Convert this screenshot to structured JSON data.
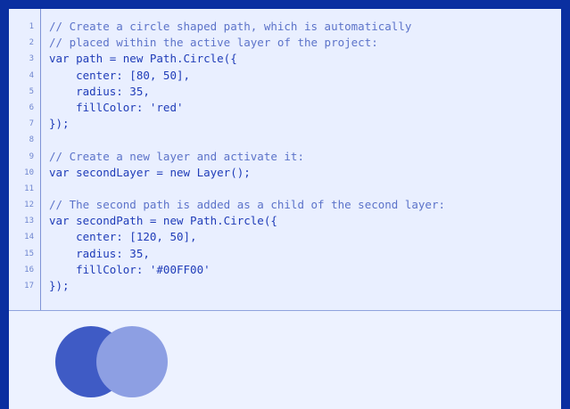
{
  "code_lines": [
    {
      "n": "1",
      "text": "// Create a circle shaped path, which is automatically",
      "kind": "comment"
    },
    {
      "n": "2",
      "text": "// placed within the active layer of the project:",
      "kind": "comment"
    },
    {
      "n": "3",
      "text": "var path = new Path.Circle({",
      "kind": "code"
    },
    {
      "n": "4",
      "text": "    center: [80, 50],",
      "kind": "code"
    },
    {
      "n": "5",
      "text": "    radius: 35,",
      "kind": "code"
    },
    {
      "n": "6",
      "text": "    fillColor: 'red'",
      "kind": "code"
    },
    {
      "n": "7",
      "text": "});",
      "kind": "code"
    },
    {
      "n": "8",
      "text": "",
      "kind": "code"
    },
    {
      "n": "9",
      "text": "// Create a new layer and activate it:",
      "kind": "comment"
    },
    {
      "n": "10",
      "text": "var secondLayer = new Layer();",
      "kind": "code"
    },
    {
      "n": "11",
      "text": "",
      "kind": "code"
    },
    {
      "n": "12",
      "text": "// The second path is added as a child of the second layer:",
      "kind": "comment"
    },
    {
      "n": "13",
      "text": "var secondPath = new Path.Circle({",
      "kind": "code"
    },
    {
      "n": "14",
      "text": "    center: [120, 50],",
      "kind": "code"
    },
    {
      "n": "15",
      "text": "    radius: 35,",
      "kind": "code"
    },
    {
      "n": "16",
      "text": "    fillColor: '#00FF00'",
      "kind": "code"
    },
    {
      "n": "17",
      "text": "});",
      "kind": "code"
    }
  ],
  "canvas": {
    "circles": [
      {
        "name": "first-circle",
        "color": "#3f5bc5"
      },
      {
        "name": "second-circle",
        "color": "#8d9fe3"
      }
    ]
  },
  "colors": {
    "frame": "#0a2fa0",
    "editor_bg": "#e9efff",
    "canvas_bg": "#edf2ff"
  }
}
